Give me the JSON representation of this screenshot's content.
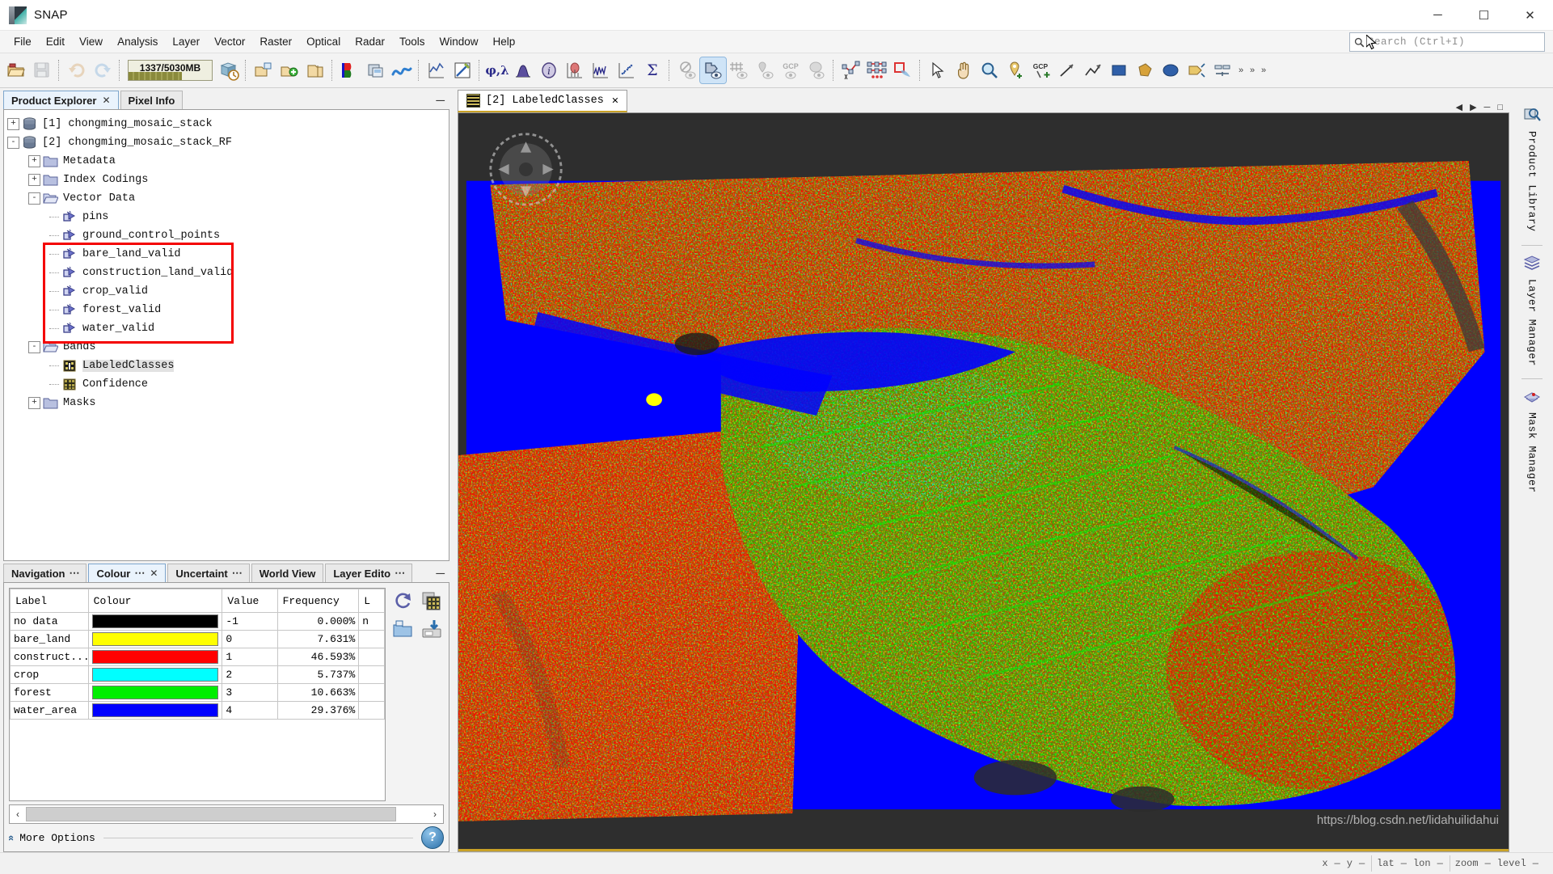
{
  "window": {
    "title": "SNAP",
    "minimize": "─",
    "maximize": "☐",
    "close": "✕"
  },
  "menubar": {
    "items": [
      "File",
      "Edit",
      "View",
      "Analysis",
      "Layer",
      "Vector",
      "Raster",
      "Optical",
      "Radar",
      "Tools",
      "Window",
      "Help"
    ]
  },
  "search": {
    "placeholder": "Search (Ctrl+I)"
  },
  "toolbar": {
    "memory_text": "1337/5030MB",
    "memory_percent": 26,
    "buttons": [
      {
        "name": "open-product-icon",
        "tip": "Open Product"
      },
      {
        "name": "save-product-icon",
        "tip": "Save Product"
      },
      {
        "name": "undo-icon",
        "tip": "Undo"
      },
      {
        "name": "redo-icon",
        "tip": "Redo"
      },
      {
        "name": "product-time-icon",
        "tip": "Product Time"
      },
      {
        "name": "open-raster-icon",
        "tip": "Open Raster"
      },
      {
        "name": "import-vector-icon",
        "tip": "Import Vector"
      },
      {
        "name": "export-icon",
        "tip": "Export"
      },
      {
        "name": "rgb-image-icon",
        "tip": "Open RGB Image View"
      },
      {
        "name": "image-window-icon",
        "tip": "Open Image Window"
      },
      {
        "name": "wavelength-icon",
        "tip": "Spectrum"
      },
      {
        "name": "profile-plot-icon",
        "tip": "Profile Plot"
      },
      {
        "name": "colour-manip-icon",
        "tip": "Colour Manipulation"
      },
      {
        "name": "phi-lambda-icon",
        "tip": "Phi Lambda"
      },
      {
        "name": "histogram-icon",
        "tip": "Histogram"
      },
      {
        "name": "information-icon",
        "tip": "Information"
      },
      {
        "name": "density-plot-icon",
        "tip": "Density Plot"
      },
      {
        "name": "spectrum-view-icon",
        "tip": "Spectrum View"
      },
      {
        "name": "scatter-plot-icon",
        "tip": "Scatter Plot"
      },
      {
        "name": "statistics-icon",
        "tip": "Statistics"
      },
      {
        "name": "no-data-overlay-icon",
        "tip": "No-Data Overlay"
      },
      {
        "name": "geometry-overlay-icon",
        "tip": "Geometry Overlay"
      },
      {
        "name": "graticule-overlay-icon",
        "tip": "Graticule Overlay"
      },
      {
        "name": "pin-overlay-icon",
        "tip": "Pin Overlay"
      },
      {
        "name": "gcp-overlay-icon",
        "tip": "GCP Overlay"
      },
      {
        "name": "mask-overlay-icon",
        "tip": "Mask Overlay"
      },
      {
        "name": "polyline-drawing-icon",
        "tip": "Polyline Drawing"
      },
      {
        "name": "magic-wand-icon",
        "tip": "Magic Wand"
      },
      {
        "name": "subset-icon",
        "tip": "Subset"
      },
      {
        "name": "selection-tool-icon",
        "tip": "Selection"
      },
      {
        "name": "pan-tool-icon",
        "tip": "Pan"
      },
      {
        "name": "zoom-tool-icon",
        "tip": "Zoom"
      },
      {
        "name": "pin-tool-icon",
        "tip": "Pin Placing Tool"
      },
      {
        "name": "gcp-tool-icon",
        "tip": "GCP Placing Tool"
      },
      {
        "name": "line-drawing-icon",
        "tip": "Line Drawing Tool"
      },
      {
        "name": "polyline-tool-icon",
        "tip": "Polyline Drawing Tool"
      },
      {
        "name": "rectangle-tool-icon",
        "tip": "Rectangle Drawing Tool"
      },
      {
        "name": "polygon-tool-icon",
        "tip": "Polygon Drawing Tool"
      },
      {
        "name": "ellipse-tool-icon",
        "tip": "Ellipse Drawing Tool"
      },
      {
        "name": "magic-stick-icon",
        "tip": "Magic Stick"
      },
      {
        "name": "range-finder-icon",
        "tip": "Range Finder"
      }
    ],
    "overflow_chevron": "»"
  },
  "explorer": {
    "tabs": [
      {
        "label": "Product Explorer",
        "selected": true,
        "closable": true
      },
      {
        "label": "Pixel Info",
        "selected": false,
        "closable": false
      }
    ],
    "minimize": "─",
    "tree": [
      {
        "indent": 0,
        "expander": "+",
        "icon": "product-icon",
        "label": "[1] chongming_mosaic_stack",
        "selected": false
      },
      {
        "indent": 0,
        "expander": "-",
        "icon": "product-icon",
        "label": "[2] chongming_mosaic_stack_RF",
        "selected": false
      },
      {
        "indent": 1,
        "expander": "+",
        "icon": "folder-icon",
        "label": "Metadata",
        "selected": false
      },
      {
        "indent": 1,
        "expander": "+",
        "icon": "folder-icon",
        "label": "Index Codings",
        "selected": false
      },
      {
        "indent": 1,
        "expander": "-",
        "icon": "folder-open-icon",
        "label": "Vector Data",
        "selected": false
      },
      {
        "indent": 2,
        "expander": "",
        "icon": "vector-icon",
        "label": "pins",
        "selected": false
      },
      {
        "indent": 2,
        "expander": "",
        "icon": "vector-icon",
        "label": "ground_control_points",
        "selected": false
      },
      {
        "indent": 2,
        "expander": "",
        "icon": "vector-icon",
        "label": "bare_land_valid",
        "selected": false
      },
      {
        "indent": 2,
        "expander": "",
        "icon": "vector-icon",
        "label": "construction_land_valid",
        "selected": false
      },
      {
        "indent": 2,
        "expander": "",
        "icon": "vector-icon",
        "label": "crop_valid",
        "selected": false
      },
      {
        "indent": 2,
        "expander": "",
        "icon": "vector-icon",
        "label": "forest_valid",
        "selected": false
      },
      {
        "indent": 2,
        "expander": "",
        "icon": "vector-icon",
        "label": "water_valid",
        "selected": false
      },
      {
        "indent": 1,
        "expander": "-",
        "icon": "folder-open-icon",
        "label": "Bands",
        "selected": false
      },
      {
        "indent": 2,
        "expander": "",
        "icon": "band-index-icon",
        "label": "LabeledClasses",
        "selected": true
      },
      {
        "indent": 2,
        "expander": "",
        "icon": "band-icon",
        "label": "Confidence",
        "selected": false
      },
      {
        "indent": 1,
        "expander": "+",
        "icon": "folder-icon",
        "label": "Masks",
        "selected": false
      }
    ],
    "highlight_color": "#f40000"
  },
  "colour_panel": {
    "tabs": [
      {
        "label": "Navigation",
        "dots": "⋯",
        "selected": false,
        "closable": false
      },
      {
        "label": "Colour",
        "dots": "⋯",
        "selected": true,
        "closable": true
      },
      {
        "label": "Uncertaint",
        "dots": "⋯",
        "selected": false,
        "closable": false
      },
      {
        "label": "World View",
        "dots": "",
        "selected": false,
        "closable": false
      },
      {
        "label": "Layer Edito",
        "dots": "⋯",
        "selected": false,
        "closable": false
      }
    ],
    "minimize": "─",
    "table": {
      "headers": [
        "Label",
        "Colour",
        "Value",
        "Frequency",
        "L"
      ],
      "rows": [
        {
          "label": "no data",
          "colour": "#000000",
          "value": "-1",
          "frequency": "0.000%",
          "extra": "n"
        },
        {
          "label": "bare_land",
          "colour": "#ffff00",
          "value": "0",
          "frequency": "7.631%",
          "extra": ""
        },
        {
          "label": "construct...",
          "colour": "#ff0000",
          "value": "1",
          "frequency": "46.593%",
          "extra": ""
        },
        {
          "label": "crop",
          "colour": "#00ffff",
          "value": "2",
          "frequency": "5.737%",
          "extra": ""
        },
        {
          "label": "forest",
          "colour": "#00ee00",
          "value": "3",
          "frequency": "10.663%",
          "extra": ""
        },
        {
          "label": "water_area",
          "colour": "#0000ff",
          "value": "4",
          "frequency": "29.376%",
          "extra": ""
        }
      ]
    },
    "side_buttons": [
      {
        "name": "reset-icon",
        "tip": "Reset to defaults"
      },
      {
        "name": "multi-assign-icon",
        "tip": "Apply to other bands"
      },
      {
        "name": "import-palette-icon",
        "tip": "Import colour palette"
      },
      {
        "name": "export-palette-icon",
        "tip": "Export colour palette"
      }
    ],
    "scroll": {
      "left_arrow": "‹",
      "right_arrow": "›"
    },
    "more_options": {
      "label": "More Options",
      "chevron": "«"
    },
    "help_label": "?"
  },
  "view": {
    "tabs": [
      {
        "label": "[2] LabeledClasses",
        "close": "✕",
        "selected": true
      }
    ],
    "controls": [
      "◀",
      "▶",
      "─",
      "□"
    ],
    "image_alt": "classified land-cover map of Chongming island"
  },
  "right_tabs": [
    {
      "label": "Product Library",
      "icon": "product-library-icon"
    },
    {
      "label": "Layer Manager",
      "icon": "layer-manager-icon"
    },
    {
      "label": "Mask Manager",
      "icon": "mask-manager-icon"
    }
  ],
  "statusbar": {
    "fields": [
      "x",
      "y",
      "lat",
      "lon",
      "zoom",
      "level"
    ]
  },
  "watermark": "https://blog.csdn.net/lidahuilidahui",
  "colors": {
    "accent": "#c9a227",
    "selection": "#cfe4f7",
    "highlight": "#f40000"
  }
}
